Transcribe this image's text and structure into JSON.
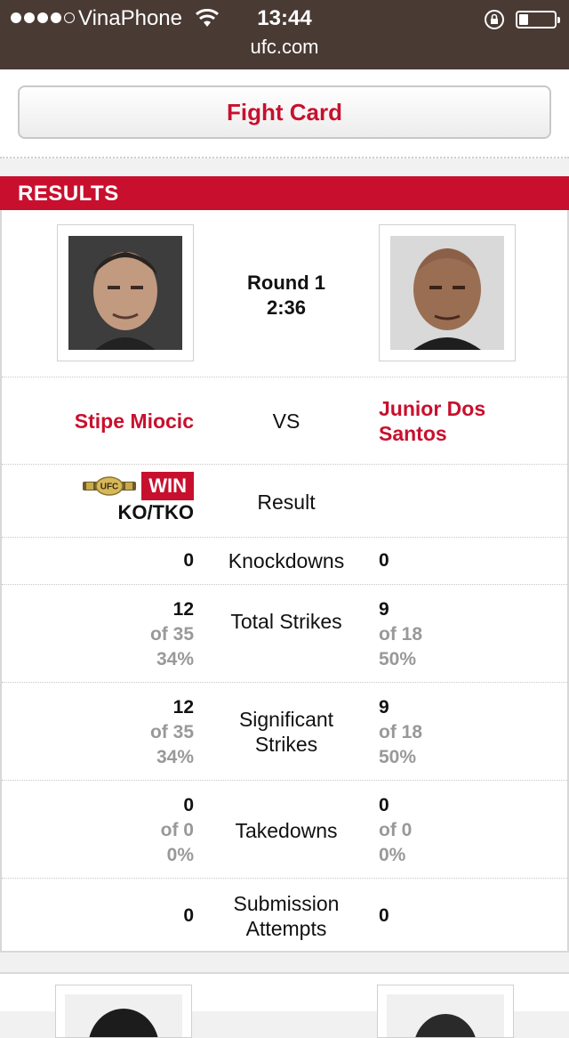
{
  "status_bar": {
    "carrier": "VinaPhone",
    "time": "13:44",
    "url": "ufc.com"
  },
  "header": {
    "fight_card_label": "Fight Card"
  },
  "results": {
    "title": "RESULTS",
    "round": "Round 1",
    "time": "2:36",
    "vs": "VS",
    "fighter_left": {
      "name": "Stipe Miocic"
    },
    "fighter_right": {
      "name": "Junior Dos Santos"
    },
    "result_row": {
      "label": "Result",
      "left_badge": "WIN",
      "left_method": "KO/TKO",
      "belt_text": "UFC"
    },
    "stats": [
      {
        "label": "Knockdowns",
        "left": {
          "value": "0"
        },
        "right": {
          "value": "0"
        }
      },
      {
        "label": "Total Strikes",
        "left": {
          "value": "12",
          "of": "of 35",
          "pct": "34%"
        },
        "right": {
          "value": "9",
          "of": "of 18",
          "pct": "50%"
        }
      },
      {
        "label": "Significant Strikes",
        "left": {
          "value": "12",
          "of": "of 35",
          "pct": "34%"
        },
        "right": {
          "value": "9",
          "of": "of 18",
          "pct": "50%"
        }
      },
      {
        "label": "Takedowns",
        "left": {
          "value": "0",
          "of": "of 0",
          "pct": "0%"
        },
        "right": {
          "value": "0",
          "of": "of 0",
          "pct": "0%"
        }
      },
      {
        "label": "Submission Attempts",
        "left": {
          "value": "0"
        },
        "right": {
          "value": "0"
        }
      }
    ]
  },
  "colors": {
    "brand_red": "#c8102e",
    "status_bar_bg": "#4a3a34"
  }
}
